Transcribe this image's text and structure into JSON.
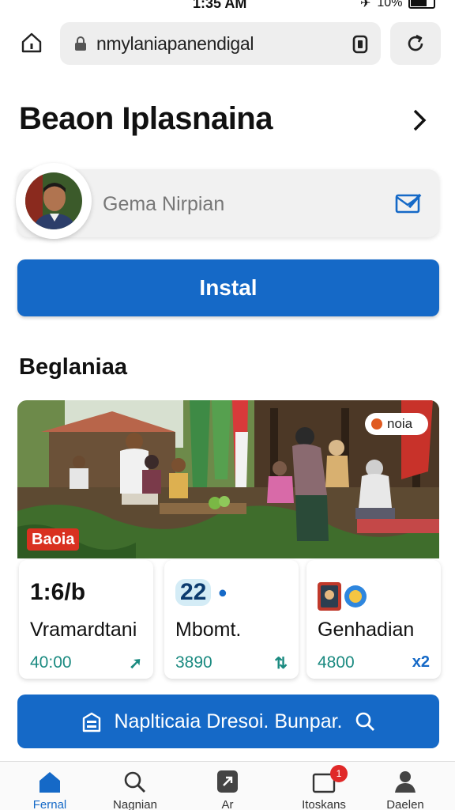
{
  "status_bar": {
    "time": "1:35 AM",
    "battery": "10%"
  },
  "browser": {
    "url": "nmylaniapanendigal"
  },
  "page": {
    "title": "Beaon Iplasnaina"
  },
  "profile": {
    "name": "Gema Nirpian"
  },
  "install_label": "Instal",
  "section": {
    "title": "Beglaniaa"
  },
  "hero": {
    "badge": "noia",
    "tag": "Baoia"
  },
  "stats": [
    {
      "big": "1:6/b",
      "label": "Vramardtani",
      "num": "40:00",
      "trend": "➚",
      "trend_color": "#1a8a80"
    },
    {
      "big": "22",
      "label": "Mbomt.",
      "num": "3890",
      "trend": "⇅",
      "trend_color": "#1a8a80"
    },
    {
      "big": "",
      "label": "Genhadian",
      "num": "4800",
      "trend": "x2",
      "trend_color": "#1569c7"
    }
  ],
  "action": {
    "label": "Naplticaia Dresoi. Bunpar."
  },
  "nav": [
    {
      "icon": "home-icon",
      "label": "Fernal"
    },
    {
      "icon": "search-icon",
      "label": "Nagnian"
    },
    {
      "icon": "puzzle-icon",
      "label": "Ar"
    },
    {
      "icon": "inbox-icon",
      "label": "Itoskans",
      "badge": "1"
    },
    {
      "icon": "profile-icon",
      "label": "Daelen"
    }
  ],
  "colors": {
    "accent": "#1569c7",
    "teal": "#1a8a80",
    "badge_red": "#e02828"
  }
}
